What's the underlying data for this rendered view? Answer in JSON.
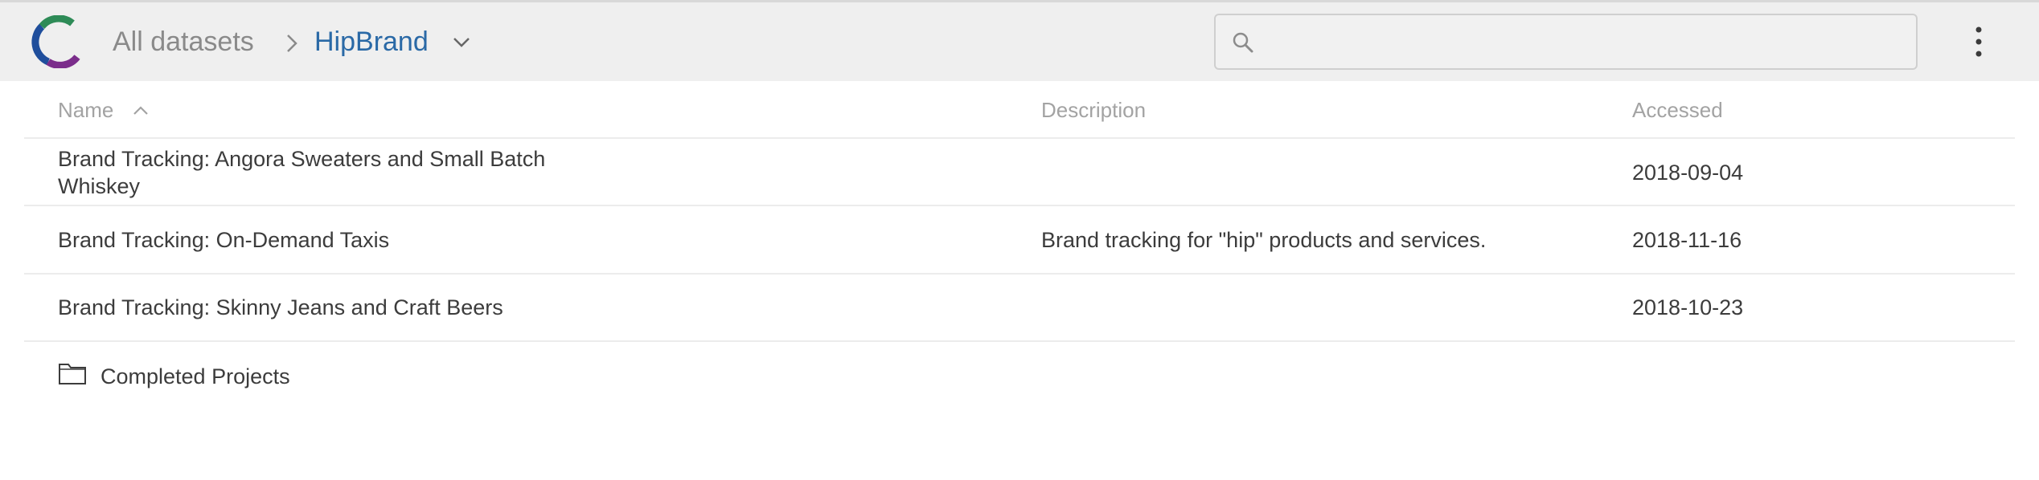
{
  "header": {
    "breadcrumb_root": "All datasets",
    "breadcrumb_current": "HipBrand",
    "search_placeholder": "",
    "search_value": ""
  },
  "table": {
    "columns": [
      "Name",
      "Description",
      "Accessed"
    ],
    "sorted_column": "Name",
    "sort_direction": "ascending",
    "rows": [
      {
        "name_line1": "Brand Tracking: Angora Sweaters and Small Batch",
        "name_line2": "Whiskey",
        "description": "",
        "accessed": "2018-09-04"
      },
      {
        "name_line1": "Brand Tracking: On-Demand Taxis",
        "name_line2": "",
        "description": "Brand tracking for \"hip\" products and services.",
        "accessed": "2018-11-16"
      },
      {
        "name_line1": "Brand Tracking: Skinny Jeans and Craft Beers",
        "name_line2": "",
        "description": "",
        "accessed": "2018-10-23"
      }
    ],
    "folders": [
      {
        "name": "Completed Projects"
      }
    ]
  },
  "icons": {
    "logo": "crunch-logo",
    "breadcrumb_separator": "chevron-right-icon",
    "dataset_menu": "chevron-down-icon",
    "search": "search-icon",
    "menu": "kebab-menu-icon",
    "sort": "chevron-up-icon",
    "folder": "folder-icon"
  },
  "colors": {
    "header_bg": "#efefef",
    "breadcrumb_current": "#2a69a6",
    "breadcrumb_root": "#8a8a8a",
    "column_header": "#a3a3a3",
    "logo_green": "#2e8b57",
    "logo_blue": "#1f4e9c",
    "logo_purple": "#7b2d8b"
  }
}
